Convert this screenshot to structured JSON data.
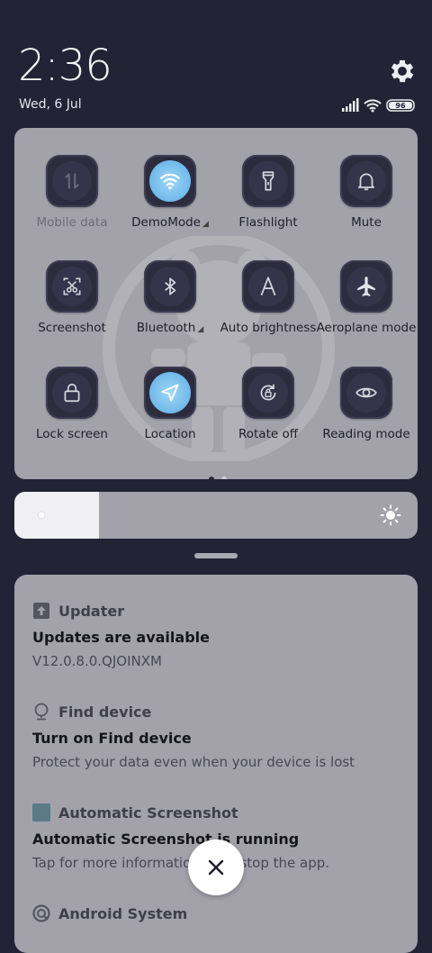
{
  "status": {
    "time": "2:36",
    "date": "Wed, 6 Jul",
    "battery": "96"
  },
  "quick_settings": {
    "tiles": [
      {
        "label": "Mobile data",
        "icon": "mobile-data-icon",
        "active": false,
        "disabled": true,
        "has_more": false
      },
      {
        "label": "DemoMode",
        "icon": "wifi-icon",
        "active": true,
        "disabled": false,
        "has_more": true
      },
      {
        "label": "Flashlight",
        "icon": "flashlight-icon",
        "active": false,
        "disabled": false,
        "has_more": false
      },
      {
        "label": "Mute",
        "icon": "bell-icon",
        "active": false,
        "disabled": false,
        "has_more": false
      },
      {
        "label": "Screenshot",
        "icon": "screenshot-icon",
        "active": false,
        "disabled": false,
        "has_more": false
      },
      {
        "label": "Bluetooth",
        "icon": "bluetooth-icon",
        "active": false,
        "disabled": false,
        "has_more": true
      },
      {
        "label": "Auto brightness",
        "icon": "auto-brightness-icon",
        "active": false,
        "disabled": false,
        "has_more": false
      },
      {
        "label": "Aeroplane mode",
        "icon": "airplane-icon",
        "active": false,
        "disabled": false,
        "has_more": false
      },
      {
        "label": "Lock screen",
        "icon": "lock-icon",
        "active": false,
        "disabled": false,
        "has_more": false
      },
      {
        "label": "Location",
        "icon": "location-icon",
        "active": true,
        "disabled": false,
        "has_more": false
      },
      {
        "label": "Rotate off",
        "icon": "rotate-lock-icon",
        "active": false,
        "disabled": false,
        "has_more": false
      },
      {
        "label": "Reading mode",
        "icon": "eye-icon",
        "active": false,
        "disabled": false,
        "has_more": false
      }
    ],
    "page_index": 0,
    "page_count": 2
  },
  "brightness": {
    "level": 0.21
  },
  "notifications": [
    {
      "app": "Updater",
      "icon": "upload-icon",
      "title": "Updates are available",
      "body": "V12.0.8.0.QJOINXM"
    },
    {
      "app": "Find device",
      "icon": "find-device-icon",
      "title": "Turn on Find device",
      "body": "Protect your data even when your device is lost"
    },
    {
      "app": "Automatic Screenshot",
      "icon": "screenshot-app-icon",
      "title": "Automatic Screenshot is running",
      "body": "Tap for more information or to stop the app."
    },
    {
      "app": "Android System",
      "icon": "android-system-icon",
      "title": "",
      "body": ""
    }
  ],
  "colors": {
    "background": "#242335",
    "panel": "#a3a2ab",
    "accent": "#6fb9ea"
  }
}
